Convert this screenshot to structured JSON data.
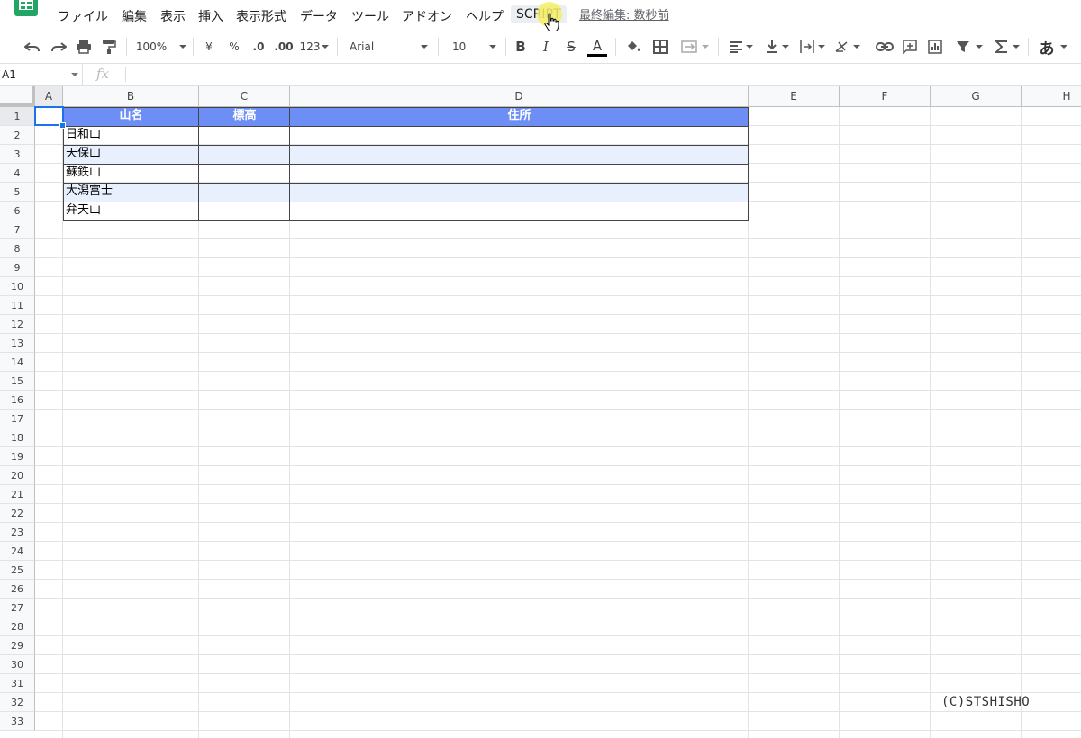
{
  "menubar": {
    "items": [
      "ファイル",
      "編集",
      "表示",
      "挿入",
      "表示形式",
      "データ",
      "ツール",
      "アドオン",
      "ヘルプ",
      "SCRIPT"
    ],
    "last_edit": "最終編集: 数秒前"
  },
  "toolbar": {
    "zoom": "100%",
    "currency": "¥",
    "percent": "%",
    "decimal_decrease": ".0",
    "decimal_increase": ".00",
    "number_format": "123",
    "font": "Arial",
    "font_size": "10",
    "bold": "B",
    "italic": "I",
    "strike": "S",
    "text_color": "A",
    "input_tools": "あ"
  },
  "formula_bar": {
    "cell_ref": "A1",
    "fx": "fx",
    "value": ""
  },
  "sheet": {
    "columns": [
      "A",
      "B",
      "C",
      "D",
      "E",
      "F",
      "G",
      "H"
    ],
    "rows": [
      "1",
      "2",
      "3",
      "4",
      "5",
      "6",
      "7",
      "8",
      "9",
      "10",
      "11",
      "12",
      "13",
      "14",
      "15",
      "16",
      "17",
      "18",
      "19",
      "20",
      "21",
      "22",
      "23",
      "24",
      "25",
      "26",
      "27",
      "28",
      "29",
      "30",
      "31",
      "32",
      "33"
    ],
    "table": {
      "headers": [
        "山名",
        "標高",
        "住所"
      ],
      "rows": [
        [
          "日和山",
          "",
          ""
        ],
        [
          "天保山",
          "",
          ""
        ],
        [
          "蘇鉄山",
          "",
          ""
        ],
        [
          "大潟富士",
          "",
          ""
        ],
        [
          "弁天山",
          "",
          ""
        ]
      ]
    },
    "header_color": "#6d8ef5",
    "band_color": "#e8f0fe",
    "selected_cell": "A1"
  },
  "copyright": "(C)STSHISHO"
}
